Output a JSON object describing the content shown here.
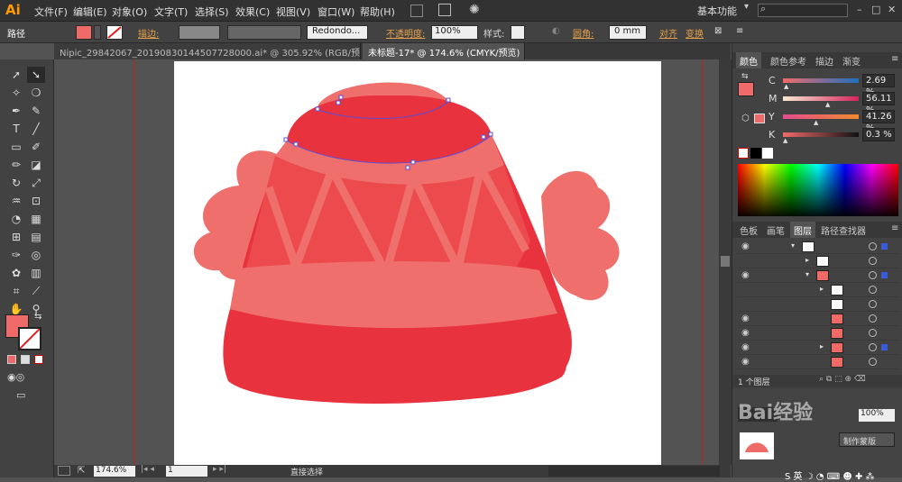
{
  "app": {
    "logo": "Ai"
  },
  "menu": [
    "文件(F)",
    "编辑(E)",
    "对象(O)",
    "文字(T)",
    "选择(S)",
    "效果(C)",
    "视图(V)",
    "窗口(W)",
    "帮助(H)"
  ],
  "workspace": {
    "label": "基本功能"
  },
  "control_bar": {
    "selection_type": "路径",
    "stroke_label": "描边:",
    "brush_label": "Redondo...",
    "opacity_label": "不透明度:",
    "opacity_value": "100%",
    "style_label": "样式:",
    "corner_label": "圆角:",
    "corner_value": "0 mm",
    "align_label": "对齐",
    "transform_label": "变换"
  },
  "tabs": [
    {
      "label": "Nipic_29842067_20190830144507728000.ai* @ 305.92% (RGB/预览)"
    },
    {
      "label": "未标题-17* @ 174.6% (CMYK/预览)"
    }
  ],
  "color_panel": {
    "tabs": [
      "颜色",
      "颜色参考",
      "描边",
      "渐变"
    ],
    "channels": [
      {
        "name": "C",
        "value": "2.69 %"
      },
      {
        "name": "M",
        "value": "56.11 %"
      },
      {
        "name": "Y",
        "value": "41.26 %"
      },
      {
        "name": "K",
        "value": "0.3 %"
      }
    ]
  },
  "layers_panel": {
    "tabs": [
      "色板",
      "画笔",
      "图层",
      "路径查找器"
    ],
    "count_label": "1 个图层"
  },
  "lower_panel": {
    "make_mask_label": "制作蒙版"
  },
  "status": {
    "zoom": "174.6%",
    "page": "1",
    "tool": "直接选择"
  },
  "colors": {
    "accent": "#ef6b6a",
    "dark_red": "#e8323e",
    "light_red": "#ef6f6c"
  },
  "watermark": "Bai经验"
}
